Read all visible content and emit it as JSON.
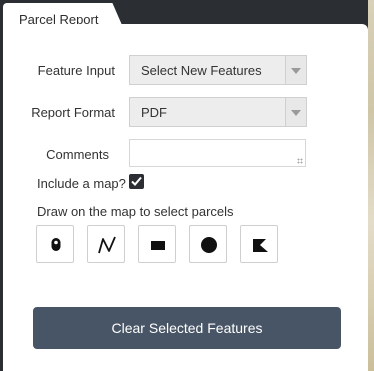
{
  "tab": {
    "title": "Parcel Report"
  },
  "form": {
    "feature_input": {
      "label": "Feature Input",
      "value": "Select New Features"
    },
    "report_format": {
      "label": "Report Format",
      "value": "PDF"
    },
    "comments": {
      "label": "Comments",
      "value": ""
    },
    "include_map": {
      "label": "Include a map?",
      "checked": true
    }
  },
  "draw": {
    "instruction": "Draw on the map to select parcels",
    "tools": [
      {
        "icon": "point-marker-icon"
      },
      {
        "icon": "polyline-icon"
      },
      {
        "icon": "rectangle-icon"
      },
      {
        "icon": "circle-icon"
      },
      {
        "icon": "polygon-icon"
      }
    ]
  },
  "actions": {
    "clear_label": "Clear Selected Features"
  },
  "colors": {
    "frame": "#2b2f33",
    "button": "#485566",
    "checkbox": "#2b2f33"
  }
}
